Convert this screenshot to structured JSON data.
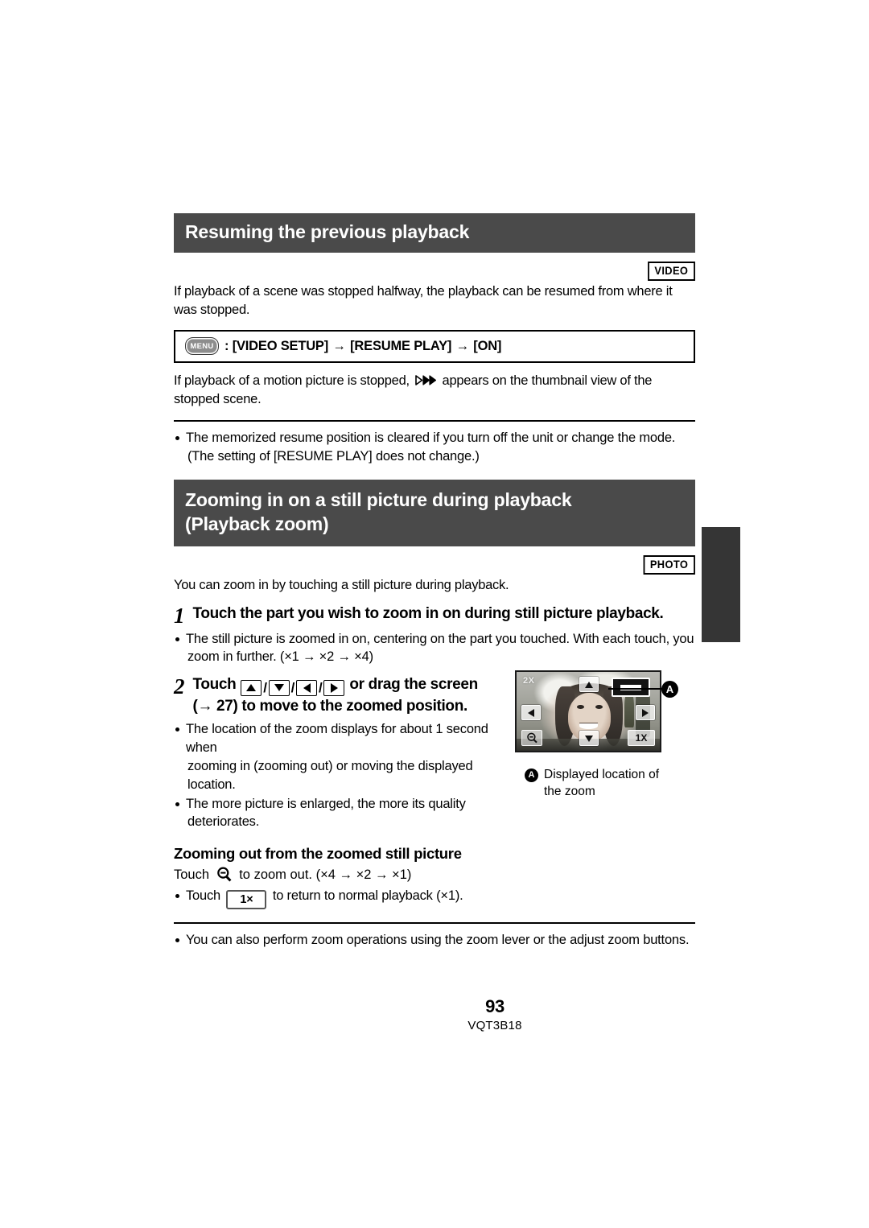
{
  "page": {
    "number": "93",
    "doc_code": "VQT3B18"
  },
  "section1": {
    "title": "Resuming the previous playback",
    "badge": "VIDEO",
    "intro": "If playback of a scene was stopped halfway, the playback can be resumed from where it was stopped.",
    "menu_box": {
      "chip_label": "MENU",
      "prefix": ":",
      "item1": "[VIDEO SETUP]",
      "arrow1": "→",
      "item2": "[RESUME PLAY]",
      "arrow2": "→",
      "item3": "[ON]"
    },
    "note_before_glyph": "If playback of a motion picture is stopped,",
    "note_after_glyph": "appears on the thumbnail view of the stopped scene.",
    "bullets": [
      {
        "text": "The memorized resume position is cleared if you turn off the unit or change the mode.",
        "cont": "(The setting of [RESUME PLAY] does not change.)"
      }
    ]
  },
  "section2": {
    "title_line1": "Zooming in on a still picture during playback",
    "title_line2": "(Playback zoom)",
    "badge": "PHOTO",
    "intro": "You can zoom in by touching a still picture during playback.",
    "step1": {
      "number": "1",
      "text": "Touch the part you wish to zoom in on during still picture playback.",
      "bullet": "The still picture is zoomed in on, centering on the part you touched. With each touch, you",
      "bullet_cont": "zoom in further. (×1 → ×2 → ×4)"
    },
    "step2": {
      "number": "2",
      "text_before_keys": "Touch",
      "keys": [
        "up",
        "down",
        "left",
        "right"
      ],
      "key_separator": "/",
      "text_after_keys": "or drag the screen",
      "text_line2": "(→ 27) to move to the zoomed position.",
      "bullets": [
        {
          "text": "The location of the zoom displays for about 1 second when",
          "cont": "zooming in (zooming out) or moving the displayed location."
        },
        {
          "text": "The more picture is enlarged, the more its quality",
          "cont": "deteriorates."
        }
      ]
    },
    "illustration": {
      "zoom_label": "2X",
      "one_x_label": "1X",
      "callout_mark": "A",
      "caption_mark": "A",
      "caption_line1": "Displayed location of",
      "caption_line2": "the zoom"
    },
    "subsection": {
      "title": "Zooming out from the zoomed still picture",
      "line1_before": "Touch",
      "line1_after": "to zoom out. (×4 → ×2 → ×1)",
      "bullet_before": "Touch",
      "bullet_chip": "1×",
      "bullet_after": "to return to normal playback (×1)."
    },
    "final_bullet": "You can also perform zoom operations using the zoom lever or the adjust zoom buttons."
  },
  "colors": {
    "header_bar": "#4a4a4a",
    "thumb_tab": "#353535",
    "text": "#000000"
  }
}
